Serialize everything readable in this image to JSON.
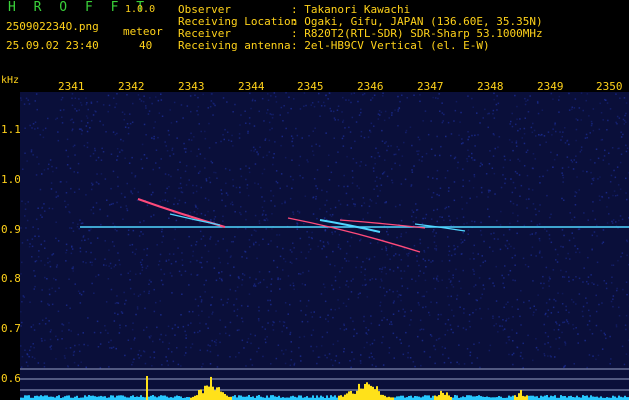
{
  "header": {
    "app_name": "H R O F F T",
    "version": "1.0.0",
    "filename": "250902234O.png",
    "mode_label": "meteor",
    "datetime": "25.09.02 23:40",
    "count": "40"
  },
  "info": [
    {
      "label": "Observer",
      "value": ": Takanori Kawachi"
    },
    {
      "label": "Receiving Location",
      "value": ": Ogaki, Gifu, JAPAN (136.60E, 35.35N)"
    },
    {
      "label": "Receiver",
      "value": ": R820T2(RTL-SDR) SDR-Sharp 53.1000MHz"
    },
    {
      "label": "Receiving antenna",
      "value": ": 2el-HB9CV Vertical (el. E-W)"
    }
  ],
  "axis": {
    "y_unit": "kHz",
    "x_ticks": [
      "2341",
      "2342",
      "2343",
      "2344",
      "2345",
      "2346",
      "2347",
      "2348",
      "2349",
      "2350"
    ],
    "y_ticks": [
      "1.1",
      "1.0",
      "0.9",
      "0.8",
      "0.7",
      "0.6"
    ]
  },
  "colors": {
    "label_text": "#ffd21a",
    "brand_text": "#3ad13a",
    "background_noise": "#1a2a8c",
    "carrier_line": "#4fd6ff",
    "echo_color": "#ff4a7a",
    "signal_bars": "#ffe11a",
    "noise_floor": "#27c8ff"
  }
}
